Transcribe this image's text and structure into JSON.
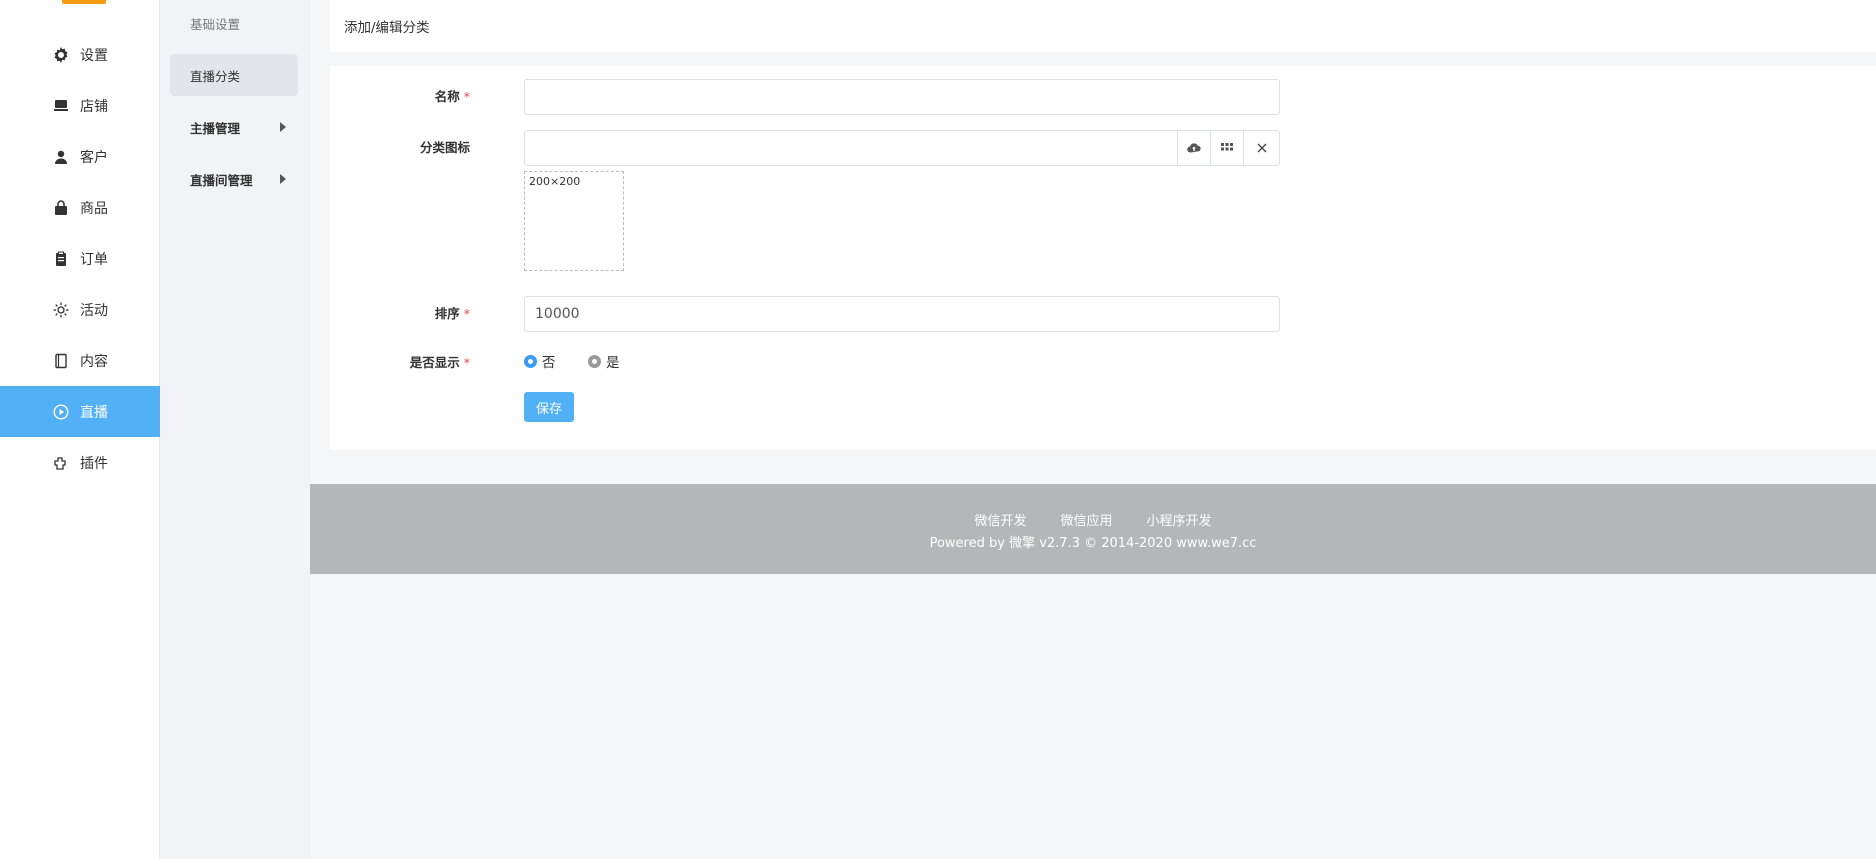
{
  "sidebar": {
    "items": [
      {
        "label": "设置",
        "icon": "gear-icon"
      },
      {
        "label": "店铺",
        "icon": "store-icon"
      },
      {
        "label": "客户",
        "icon": "user-icon"
      },
      {
        "label": "商品",
        "icon": "bag-icon"
      },
      {
        "label": "订单",
        "icon": "clipboard-icon"
      },
      {
        "label": "活动",
        "icon": "sun-icon"
      },
      {
        "label": "内容",
        "icon": "notebook-icon"
      },
      {
        "label": "直播",
        "icon": "play-circle-icon",
        "active": true
      },
      {
        "label": "插件",
        "icon": "plugin-icon"
      }
    ],
    "accent": "#52b0f6",
    "logo_color": "#f39c12"
  },
  "subnav": {
    "items": [
      {
        "label": "基础设置"
      },
      {
        "label": "直播分类",
        "active": true
      },
      {
        "label": "主播管理",
        "expandable": true
      },
      {
        "label": "直播间管理",
        "expandable": true
      }
    ]
  },
  "header": {
    "title": "添加/编辑分类"
  },
  "form": {
    "name": {
      "label": "名称",
      "required_mark": "*",
      "value": ""
    },
    "icon": {
      "label": "分类图标",
      "value": "",
      "thumb_text": "200×200"
    },
    "sort": {
      "label": "排序",
      "required_mark": "*",
      "value": "10000"
    },
    "visible": {
      "label": "是否显示",
      "required_mark": "*",
      "options": [
        {
          "label": "否",
          "selected": true
        },
        {
          "label": "是",
          "selected": false
        }
      ]
    },
    "save_label": "保存"
  },
  "footer": {
    "links": [
      "微信开发",
      "微信应用",
      "小程序开发"
    ],
    "copyright": "Powered by 微擎 v2.7.3 © 2014-2020 www.we7.cc"
  }
}
